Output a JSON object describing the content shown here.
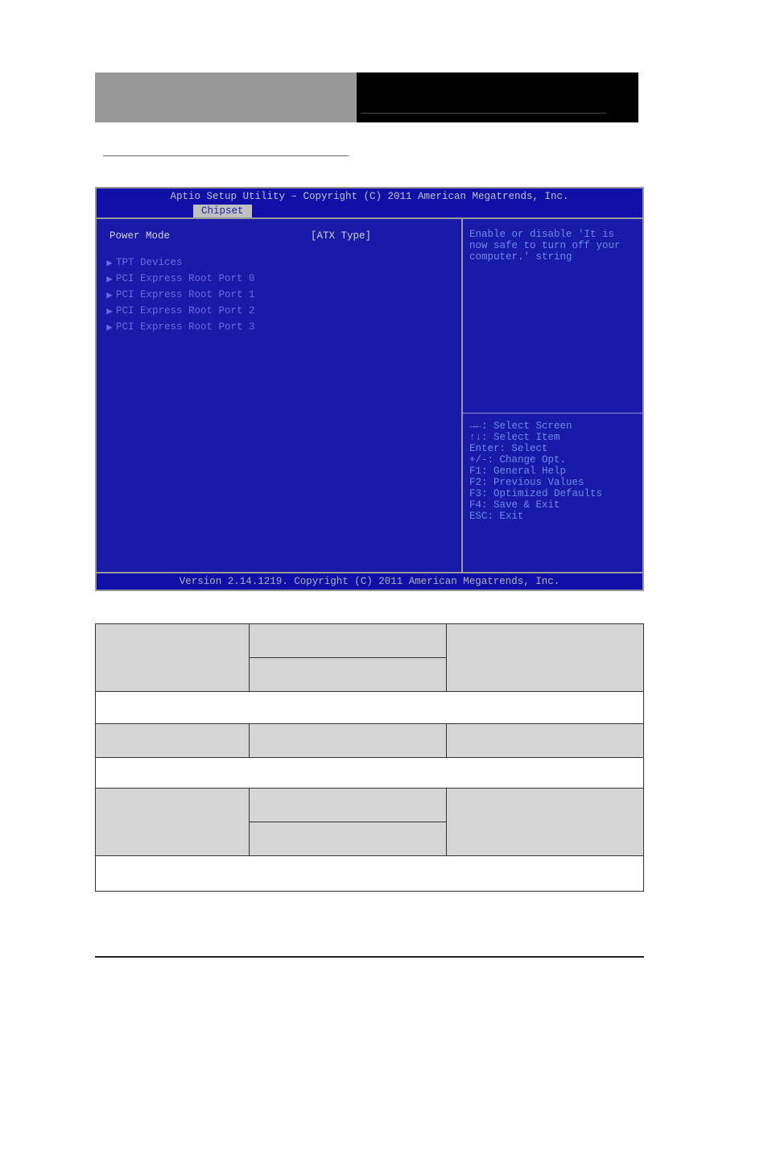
{
  "bios": {
    "title": "Aptio Setup Utility – Copyright (C) 2011 American Megatrends, Inc.",
    "active_tab": "Chipset",
    "selected_item": {
      "label": "Power Mode",
      "value": "[ATX Type]"
    },
    "submenus": [
      "TPT Devices",
      "PCI Express Root Port 0",
      "PCI Express Root Port 1",
      "PCI Express Root Port 2",
      "PCI Express Root Port 3"
    ],
    "help_text": "Enable or disable 'It is now safe to turn off your computer.' string",
    "key_help": [
      "→←: Select Screen",
      "↑↓: Select Item",
      "Enter: Select",
      "+/-: Change Opt.",
      "F1: General Help",
      "F2: Previous Values",
      "F3: Optimized Defaults",
      "F4: Save & Exit",
      "ESC: Exit"
    ],
    "footer": "Version 2.14.1219. Copyright (C) 2011 American Megatrends, Inc."
  },
  "table": {
    "rows": [
      {
        "name": "",
        "opt1": "",
        "opt2": "",
        "desc": "",
        "shaded": true,
        "rowspan2": true
      },
      {
        "full": "",
        "shaded": false
      },
      {
        "name": "",
        "opt1": "",
        "desc": "",
        "shaded": true,
        "rowspan2": false
      },
      {
        "full": "",
        "shaded": false
      },
      {
        "name": "",
        "opt1": "",
        "opt2": "",
        "desc": "",
        "shaded": true,
        "rowspan2": true
      },
      {
        "full": "",
        "shaded": false
      }
    ]
  }
}
